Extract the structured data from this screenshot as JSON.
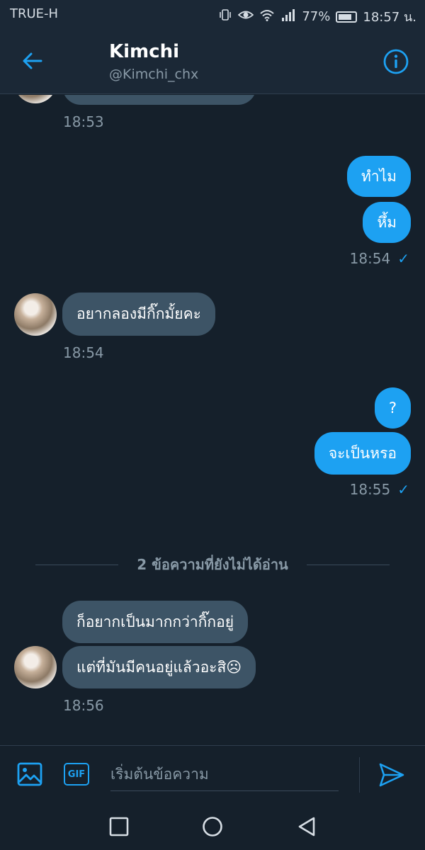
{
  "status_bar": {
    "carrier": "TRUE-H",
    "battery": "77%",
    "time": "18:57 น."
  },
  "header": {
    "name": "Kimchi",
    "handle": "@Kimchi_chx"
  },
  "messages": [
    {
      "time": "18:53"
    },
    {
      "text": "ทำไม"
    },
    {
      "text": "หึ้ม"
    },
    {
      "time": "18:54",
      "read": "✓"
    },
    {
      "text": "อยากลองมีกิ๊กมั้ยคะ",
      "time": "18:54"
    },
    {
      "text": "?"
    },
    {
      "text": "จะเป็นหรอ"
    },
    {
      "time": "18:55",
      "read": "✓"
    },
    {
      "text": "ก็อยากเป็นมากกว่ากิ๊กอยู่"
    },
    {
      "text": "แต่ที่มันมีคนอยู่แล้วอะสิ☹",
      "time": "18:56"
    }
  ],
  "unread_divider": "2 ข้อความที่ยังไม่ได้อ่าน",
  "composer": {
    "placeholder": "เริ่มต้นข้อความ",
    "gif_label": "GIF"
  },
  "colors": {
    "accent": "#1da1f2",
    "background": "#15202b",
    "incoming_bubble": "#3d5466"
  },
  "icons": [
    "back-arrow-icon",
    "info-icon",
    "image-icon",
    "gif-icon",
    "send-icon",
    "square-nav-icon",
    "circle-nav-icon",
    "triangle-nav-icon"
  ]
}
